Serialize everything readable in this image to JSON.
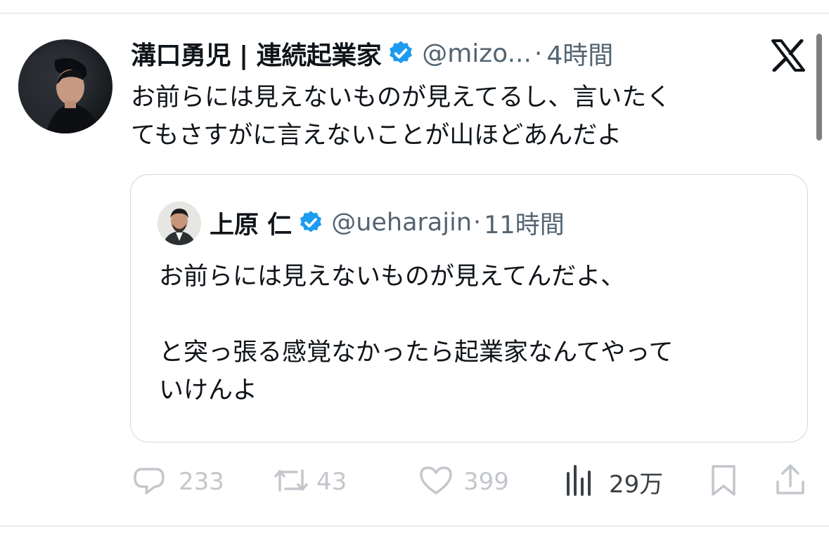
{
  "colors": {
    "verified": "#1d9bf0",
    "muted": "#c3c7cb",
    "secondary": "#536471",
    "text": "#0f1419",
    "border": "#cfd9de"
  },
  "post": {
    "author_name": "溝口勇児 | 連続起業家",
    "handle": "@mizo...",
    "separator": "·",
    "time": "4時間",
    "text": "お前らには見えないものが見えてるし、言いたく\nてもさすがに言えないことが山ほどあんだよ"
  },
  "quote": {
    "author_name": "上原 仁",
    "handle": "@ueharajin",
    "separator": "·",
    "time": "11時間",
    "text": "お前らには見えないものが見えてんだよ、\n\nと突っ張る感覚なかったら起業家なんてやって\nいけんよ"
  },
  "actions": {
    "reply_count": "233",
    "repost_count": "43",
    "like_count": "399",
    "views_count": "29万"
  },
  "icons": [
    "x-logo-icon",
    "verified-badge-icon",
    "reply-icon",
    "repost-icon",
    "like-icon",
    "views-icon",
    "bookmark-icon",
    "share-icon"
  ]
}
